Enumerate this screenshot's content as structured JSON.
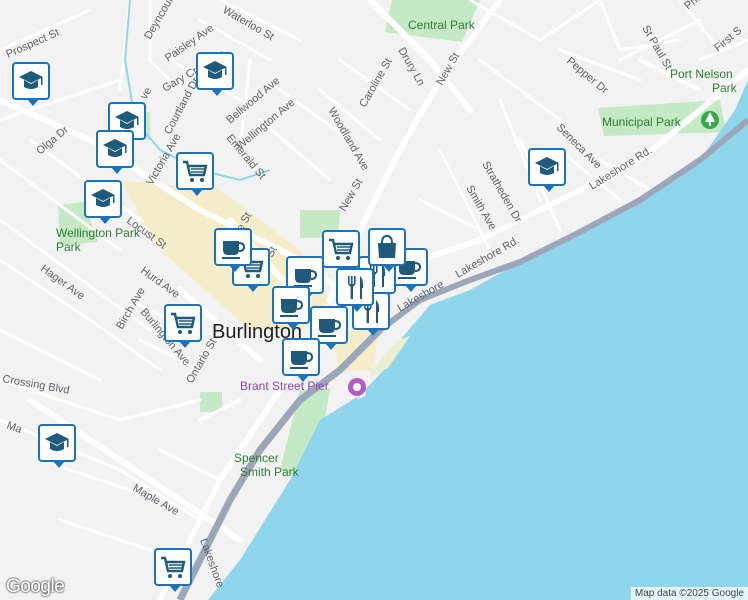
{
  "map": {
    "city_label": "Burlington",
    "poi_label": "Brant Street Pier",
    "parks": [
      "Central Park",
      "Wellington Park",
      "Municipal Park",
      "Spencer Smith Park",
      "Port Nelson Park"
    ],
    "streets": {
      "prospect": "Prospect St",
      "deyncourt": "Deyncourt Dr",
      "paisley": "Paisley Ave",
      "waterloo": "Waterloo St",
      "gary": "Gary Crescent",
      "courtland": "Courtland Dr",
      "bellwood": "Bellwood Ave",
      "wellington": "Wellington Ave",
      "emerald": "Emerald St",
      "victoria": "Victoria Ave",
      "olga": "Olga Dr",
      "locust": "Locust St",
      "hager": "Hager Ave",
      "hurd": "Hurd Ave",
      "birch": "Birch Ave",
      "burlington": "Burlington Ave",
      "ontario": "Ontario St",
      "crossing": "Crossing Blvd",
      "maple": "Maple Ave",
      "ma": "Ma",
      "lakeshore": "Lakeshore Rd.",
      "lakeshore_short": "Lakeshore",
      "lakeshore_bot": "Lakeshore",
      "new_st": "New St",
      "new_st2": "New St",
      "drury": "Drury Ln",
      "caroline": "Caroline St",
      "woodland": "Woodland Ave",
      "smith": "Smith Ave",
      "stratheden": "Stratheden Dr",
      "seneca": "Seneca Ave",
      "pepper": "Pepper Dr",
      "st_paul": "St Paul St",
      "first": "First S",
      "princ": "Princ",
      "ive": "ive",
      "ave": "ve",
      "e_st": "e St",
      "st": "St"
    },
    "markers": [
      {
        "type": "school",
        "icon": "graduation-cap-icon"
      },
      {
        "type": "school",
        "icon": "graduation-cap-icon"
      },
      {
        "type": "school",
        "icon": "graduation-cap-icon"
      },
      {
        "type": "school",
        "icon": "graduation-cap-icon"
      },
      {
        "type": "school",
        "icon": "graduation-cap-icon"
      },
      {
        "type": "school",
        "icon": "graduation-cap-icon"
      },
      {
        "type": "school",
        "icon": "graduation-cap-icon"
      },
      {
        "type": "grocery",
        "icon": "shopping-cart-icon"
      },
      {
        "type": "grocery",
        "icon": "shopping-cart-icon"
      },
      {
        "type": "grocery",
        "icon": "shopping-cart-icon"
      },
      {
        "type": "grocery",
        "icon": "shopping-cart-icon"
      },
      {
        "type": "grocery",
        "icon": "shopping-cart-icon"
      },
      {
        "type": "cafe",
        "icon": "coffee-cup-icon"
      },
      {
        "type": "cafe",
        "icon": "coffee-cup-icon"
      },
      {
        "type": "cafe",
        "icon": "coffee-cup-icon"
      },
      {
        "type": "cafe",
        "icon": "coffee-cup-icon"
      },
      {
        "type": "cafe",
        "icon": "coffee-cup-icon"
      },
      {
        "type": "cafe",
        "icon": "coffee-cup-icon"
      },
      {
        "type": "restaurant",
        "icon": "fork-knife-icon"
      },
      {
        "type": "restaurant",
        "icon": "fork-knife-icon"
      },
      {
        "type": "restaurant",
        "icon": "fork-knife-icon"
      },
      {
        "type": "shopping",
        "icon": "shopping-bag-icon"
      }
    ]
  },
  "branding": {
    "logo": "Google"
  },
  "attribution": "Map data ©2025 Google",
  "colors": {
    "water": "#8fd6eb",
    "land": "#f2f2f2",
    "park": "#c5e8c5",
    "highway": "#9ba7b8",
    "road": "#ffffff",
    "downtown": "#f5ecc9",
    "marker_border": "#1a73b8",
    "marker_icon": "#1f5a7a"
  }
}
